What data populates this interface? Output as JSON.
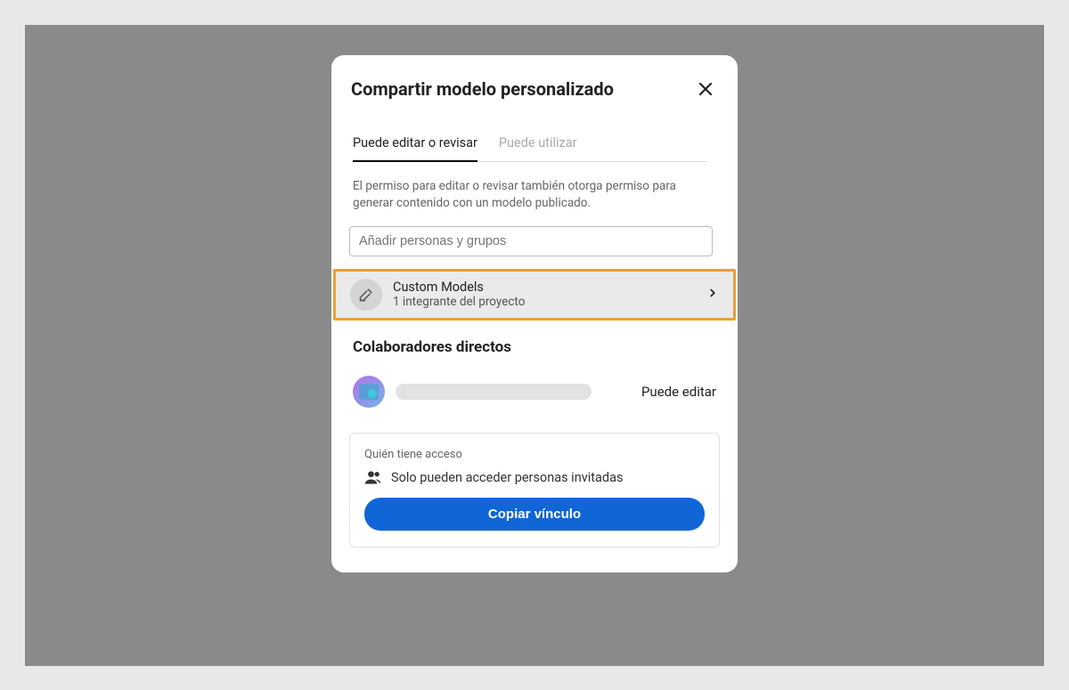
{
  "modal": {
    "title": "Compartir modelo personalizado",
    "tabs": {
      "edit": "Puede editar o revisar",
      "use": "Puede utilizar"
    },
    "description": "El permiso para editar o revisar también otorga permiso para generar contenido con un modelo publicado.",
    "add_placeholder": "Añadir personas y grupos",
    "project": {
      "name": "Custom Models",
      "subtitle": "1 integrante del proyecto"
    },
    "collaborators": {
      "heading": "Colaboradores directos",
      "permission": "Puede editar"
    },
    "access": {
      "label": "Quién tiene acceso",
      "text": "Solo pueden acceder personas invitadas",
      "copy_button": "Copiar vínculo"
    }
  }
}
